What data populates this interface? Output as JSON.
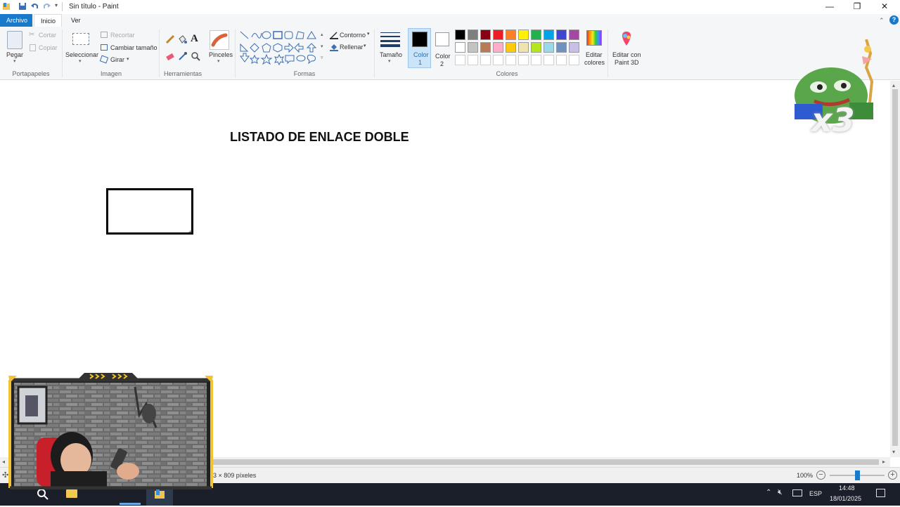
{
  "window": {
    "title": "Sin título - Paint",
    "minimize": "—",
    "maximize": "❐",
    "close": "✕"
  },
  "tabs": [
    "Archivo",
    "Inicio",
    "Ver"
  ],
  "ribbon": {
    "clipboard": {
      "label": "Portapapeles",
      "paste": "Pegar",
      "cut": "Cortar",
      "copy": "Copiar"
    },
    "image": {
      "label": "Imagen",
      "select": "Seleccionar",
      "crop": "Recortar",
      "resize": "Cambiar tamaño",
      "rotate": "Girar"
    },
    "tools": {
      "label": "Herramientas"
    },
    "brushes": {
      "label": "Pinceles"
    },
    "shapes": {
      "label": "Formas",
      "outline": "Contorno",
      "fill": "Rellenar"
    },
    "size": {
      "label": "Tamaño"
    },
    "color1": {
      "label": "Color",
      "number": "1",
      "value": "#000000"
    },
    "color2": {
      "label": "Color",
      "number": "2",
      "value": "#ffffff"
    },
    "colors": {
      "label": "Colores",
      "row1": [
        "#000000",
        "#7f7f7f",
        "#880015",
        "#ed1c24",
        "#ff7f27",
        "#fff200",
        "#22b14c",
        "#00a2e8",
        "#3f48cc",
        "#a349a4"
      ],
      "row2": [
        "#ffffff",
        "#c3c3c3",
        "#b97a57",
        "#ffaec9",
        "#ffc90e",
        "#efe4b0",
        "#b5e61d",
        "#99d9ea",
        "#7092be",
        "#c8bfe7"
      ]
    },
    "edit_colors": {
      "line1": "Editar",
      "line2": "colores"
    },
    "paint3d": {
      "line1": "Editar con",
      "line2": "Paint 3D"
    }
  },
  "canvas": {
    "title_text": "LISTADO DE ENLACE DOBLE"
  },
  "status": {
    "dimensions": "13 × 809 píxeles",
    "zoom": "100%",
    "zoom_fraction": 0.5
  },
  "taskbar": {
    "language": "ESP",
    "time": "14:48",
    "date": "18/01/2025"
  },
  "overlay": {
    "emote_text": "x3"
  }
}
